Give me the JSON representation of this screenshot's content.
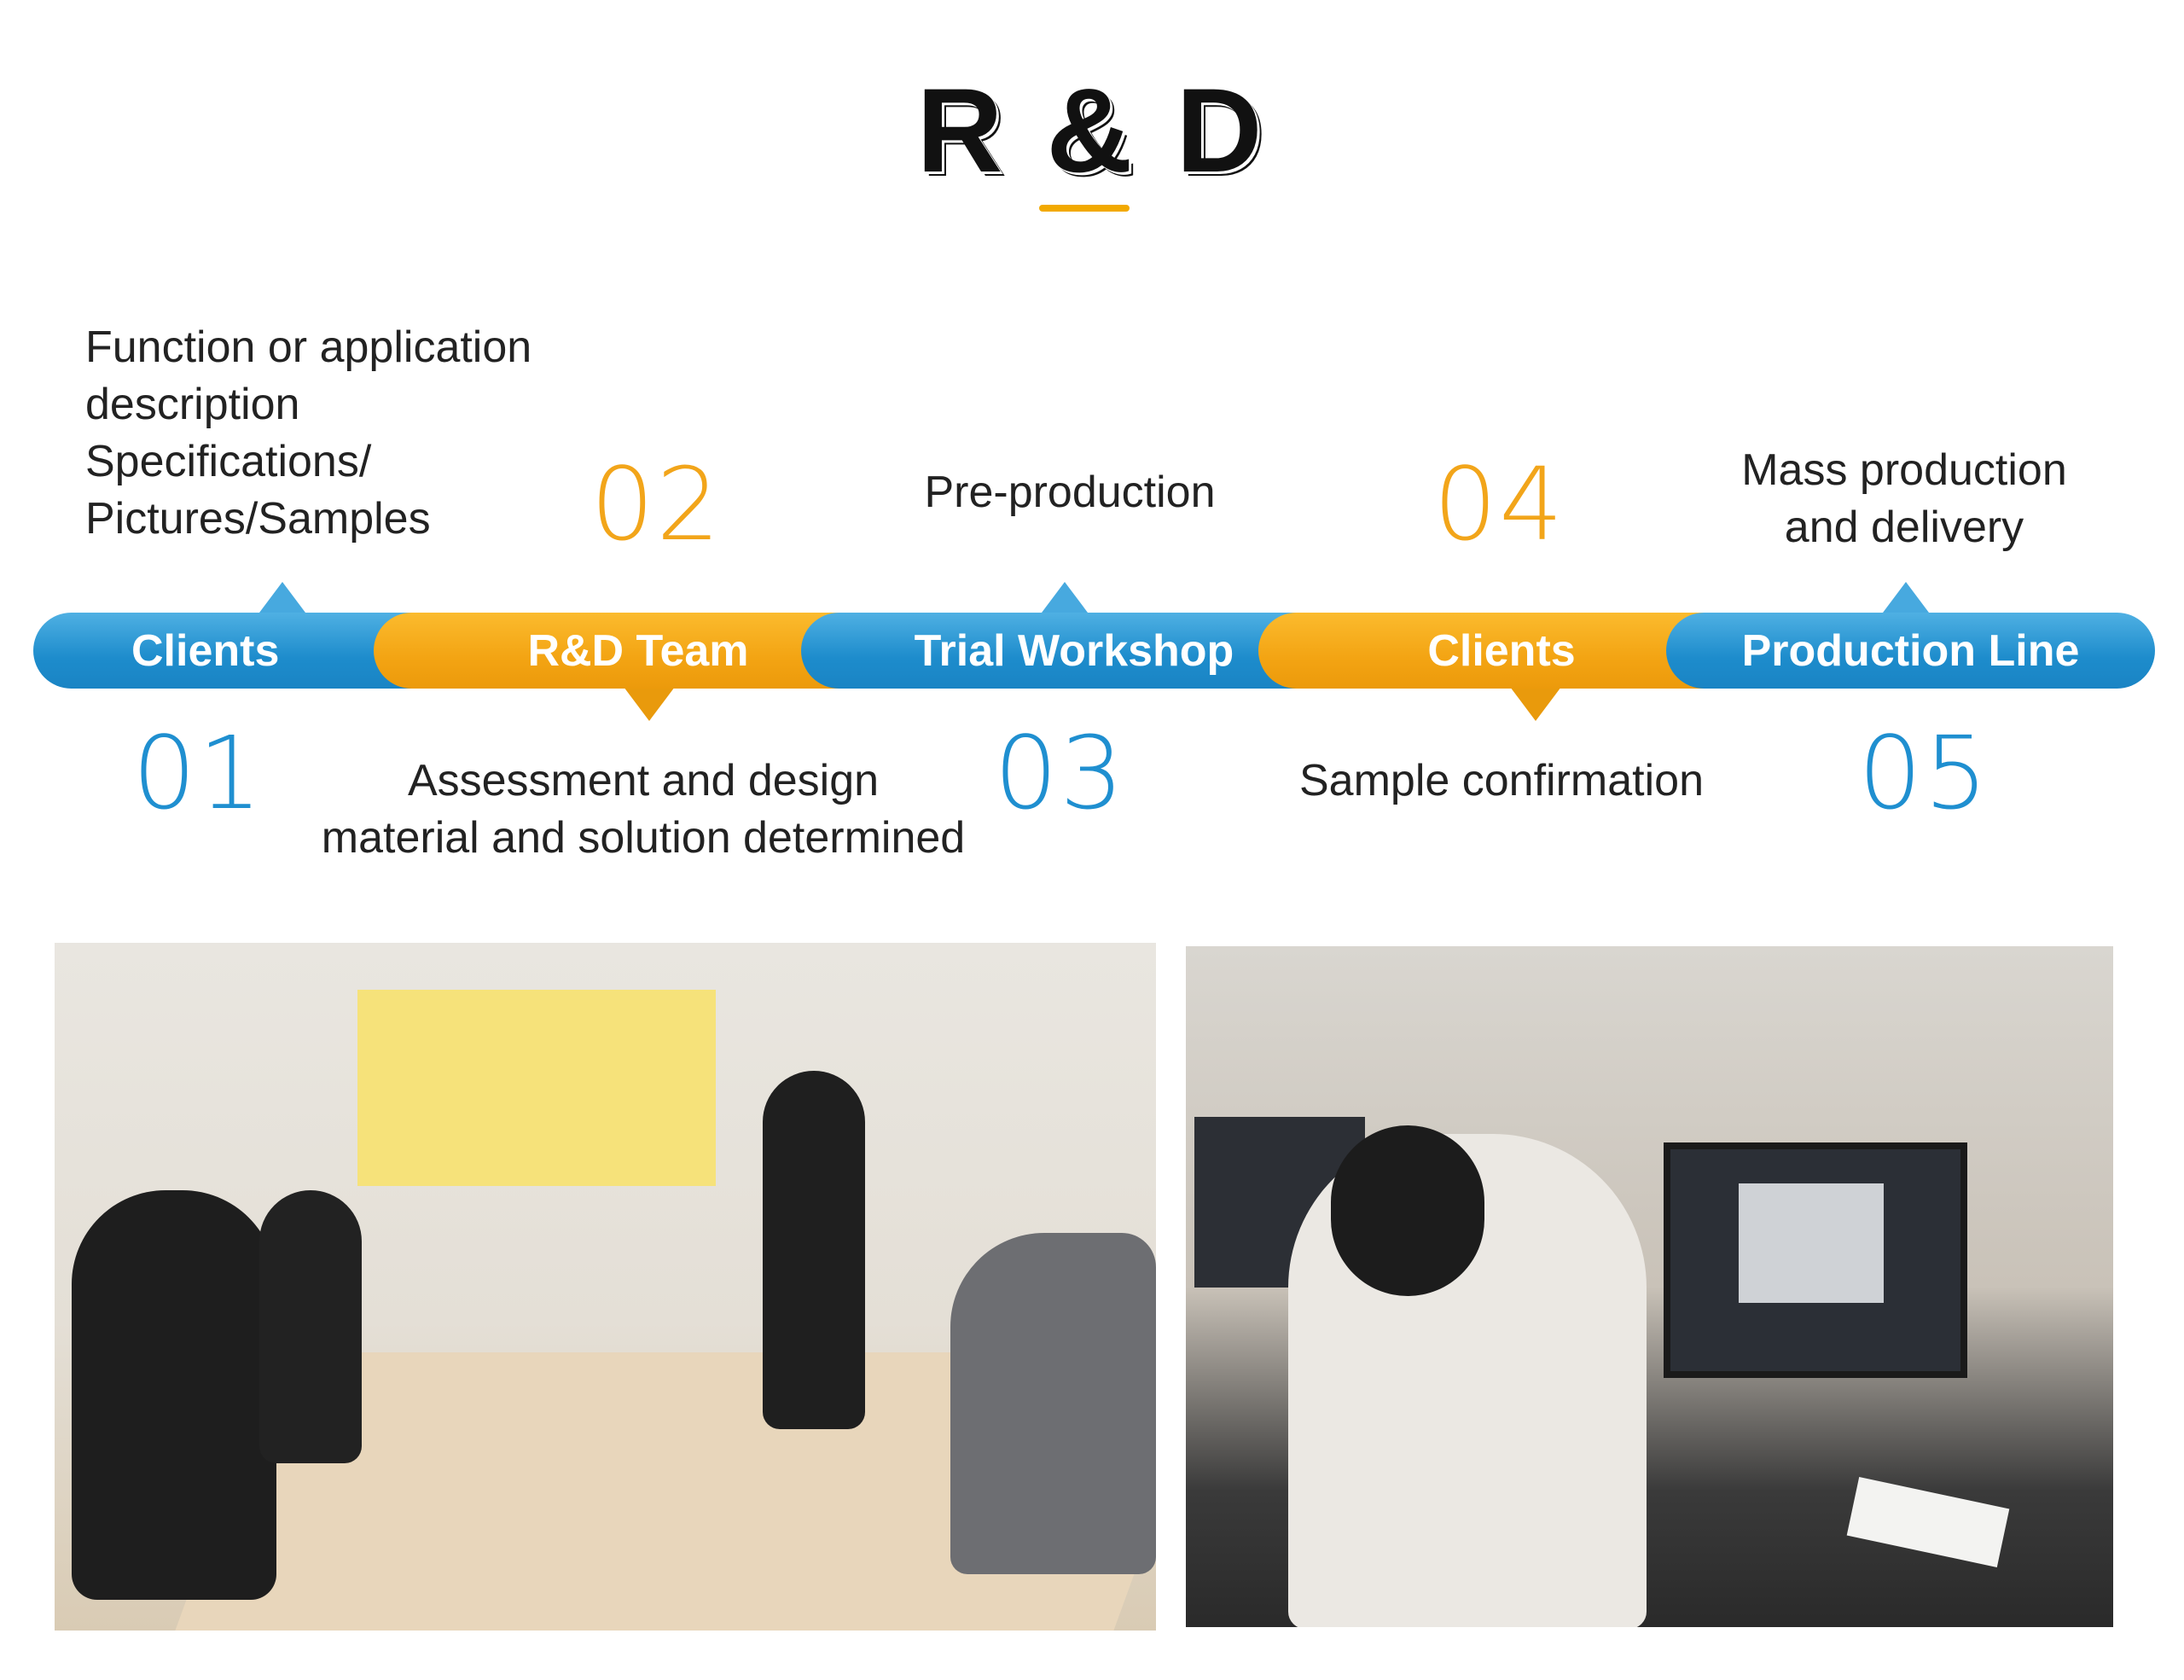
{
  "title": "R & D",
  "colors": {
    "accent_orange": "#f2a51a",
    "accent_blue": "#1f8fd0"
  },
  "steps": [
    {
      "number": "01",
      "label": "Clients",
      "color": "blue",
      "description_lines": [
        "Function or application",
        "description",
        "Specifications/",
        "Pictures/Samples"
      ]
    },
    {
      "number": "02",
      "label": "R&D Team",
      "color": "orange",
      "description_lines": [
        "Assessment and design",
        "material and solution determined"
      ]
    },
    {
      "number": "03",
      "label": "Trial Workshop",
      "color": "blue",
      "description_lines": [
        "Pre-production"
      ]
    },
    {
      "number": "04",
      "label": "Clients",
      "color": "orange",
      "description_lines": [
        "Sample confirmation"
      ]
    },
    {
      "number": "05",
      "label": "Production Line",
      "color": "blue",
      "description_lines": [
        "Mass production",
        "and delivery"
      ]
    }
  ],
  "photos": [
    "meeting-room-team-discussion",
    "office-workstation-designer"
  ]
}
